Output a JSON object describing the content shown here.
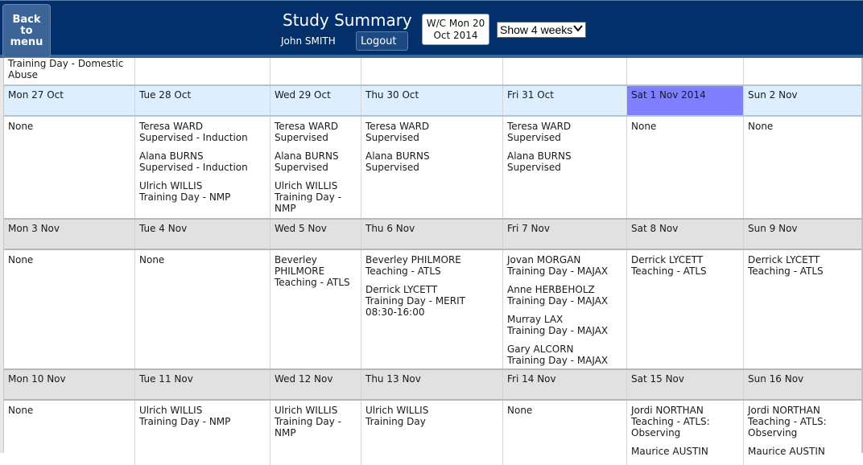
{
  "header": {
    "back_label": "Back to menu",
    "title": "Study Summary",
    "user_name": "John SMITH",
    "logout_label": "Logout",
    "week_commencing_line1": "W/C Mon 20",
    "week_commencing_line2": "Oct 2014",
    "weeks_select": {
      "selected": "Show 4 weeks",
      "icon": "chevron-down-icon"
    }
  },
  "colors": {
    "header_bg": "#03306a",
    "current_week_header_bg": "#ddeeff",
    "other_week_header_bg": "#e1e1e1",
    "today_bg": "#8080ff"
  },
  "partial_row": {
    "cells": [
      {
        "lines": [
          "Training Day - Domestic",
          "Abuse"
        ]
      },
      {
        "lines": []
      },
      {
        "lines": []
      },
      {
        "lines": []
      },
      {
        "lines": []
      },
      {
        "lines": []
      },
      {
        "lines": []
      }
    ]
  },
  "weeks": [
    {
      "days": [
        "Mon 27 Oct",
        "Tue 28 Oct",
        "Wed 29 Oct",
        "Thu 30 Oct",
        "Fri 31 Oct",
        "Sat 1 Nov 2014",
        "Sun 2 Nov"
      ],
      "today_index": 5,
      "entries": [
        [
          {
            "name": "None",
            "detail": ""
          }
        ],
        [
          {
            "name": "Teresa WARD",
            "detail": "Supervised - Induction"
          },
          {
            "name": "Alana BURNS",
            "detail": "Supervised - Induction"
          },
          {
            "name": "Ulrich WILLIS",
            "detail": "Training Day - NMP"
          }
        ],
        [
          {
            "name": "Teresa WARD",
            "detail": "Supervised"
          },
          {
            "name": "Alana BURNS",
            "detail": "Supervised"
          },
          {
            "name": "Ulrich WILLIS",
            "detail": "Training Day - NMP"
          }
        ],
        [
          {
            "name": "Teresa WARD",
            "detail": "Supervised"
          },
          {
            "name": "Alana BURNS",
            "detail": "Supervised"
          }
        ],
        [
          {
            "name": "Teresa WARD",
            "detail": "Supervised"
          },
          {
            "name": "Alana BURNS",
            "detail": "Supervised"
          }
        ],
        [
          {
            "name": "None",
            "detail": ""
          }
        ],
        [
          {
            "name": "None",
            "detail": ""
          }
        ]
      ]
    },
    {
      "days": [
        "Mon 3 Nov",
        "Tue 4 Nov",
        "Wed 5 Nov",
        "Thu 6 Nov",
        "Fri 7 Nov",
        "Sat 8 Nov",
        "Sun 9 Nov"
      ],
      "entries": [
        [
          {
            "name": "None",
            "detail": ""
          }
        ],
        [
          {
            "name": "None",
            "detail": ""
          }
        ],
        [
          {
            "name": "Beverley PHILMORE",
            "detail": "Teaching - ATLS"
          }
        ],
        [
          {
            "name": "Beverley PHILMORE",
            "detail": "Teaching - ATLS"
          },
          {
            "name": "Derrick LYCETT",
            "detail": "Training Day - MERIT 08:30-16:00"
          }
        ],
        [
          {
            "name": "Jovan MORGAN",
            "detail": "Training Day - MAJAX"
          },
          {
            "name": "Anne HERBEHOLZ",
            "detail": "Training Day - MAJAX"
          },
          {
            "name": "Murray LAX",
            "detail": "Training Day - MAJAX"
          },
          {
            "name": "Gary ALCORN",
            "detail": "Training Day - MAJAX"
          }
        ],
        [
          {
            "name": "Derrick LYCETT",
            "detail": "Teaching - ATLS"
          }
        ],
        [
          {
            "name": "Derrick LYCETT",
            "detail": "Teaching - ATLS"
          }
        ]
      ]
    },
    {
      "days": [
        "Mon 10 Nov",
        "Tue 11 Nov",
        "Wed 12 Nov",
        "Thu 13 Nov",
        "Fri 14 Nov",
        "Sat 15 Nov",
        "Sun 16 Nov"
      ],
      "entries": [
        [
          {
            "name": "None",
            "detail": ""
          }
        ],
        [
          {
            "name": "Ulrich WILLIS",
            "detail": "Training Day - NMP"
          }
        ],
        [
          {
            "name": "Ulrich WILLIS",
            "detail": "Training Day - NMP"
          }
        ],
        [
          {
            "name": "Ulrich WILLIS",
            "detail": "Training Day"
          }
        ],
        [
          {
            "name": "None",
            "detail": ""
          }
        ],
        [
          {
            "name": "Jordi NORTHAN",
            "detail": "Teaching - ATLS: Observing"
          },
          {
            "name": "Maurice AUSTIN",
            "detail": ""
          }
        ],
        [
          {
            "name": "Jordi NORTHAN",
            "detail": "Teaching - ATLS: Observing"
          },
          {
            "name": "Maurice AUSTIN",
            "detail": ""
          }
        ]
      ]
    }
  ]
}
